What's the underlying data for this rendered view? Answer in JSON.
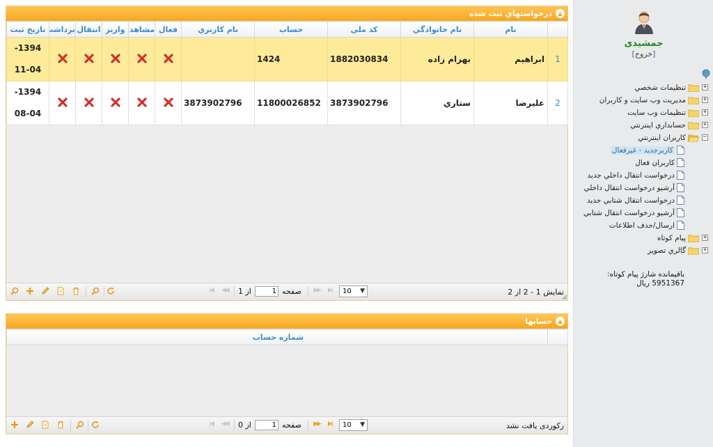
{
  "sidebar": {
    "user_name": "جمشیدی",
    "logout": "خروج",
    "tree": [
      {
        "label": "تنظيمات شخصي",
        "type": "folder",
        "expander": "+"
      },
      {
        "label": "مديريت وب سايت و کاربران",
        "type": "folder",
        "expander": "+"
      },
      {
        "label": "تنظيمات وب سايت",
        "type": "folder",
        "expander": "+"
      },
      {
        "label": "حسابداري اينترنتي",
        "type": "folder",
        "expander": "+"
      },
      {
        "label": "کاربران اينترنتي",
        "type": "folder-open",
        "expander": "−"
      },
      {
        "label": "کاربرجديد - غيرفعال",
        "type": "page",
        "selected": true
      },
      {
        "label": "کاربران فعال",
        "type": "page"
      },
      {
        "label": "درخواست انتقال داخلي جديد",
        "type": "page"
      },
      {
        "label": "آرشيو درخواست انتقال داخلي",
        "type": "page"
      },
      {
        "label": "درخواست انتقال شتابي جديد",
        "type": "page"
      },
      {
        "label": "آرشيو درخواست انتقال شتابي",
        "type": "page"
      },
      {
        "label": "ارسال/حذف اطلاعات",
        "type": "page"
      },
      {
        "label": "پيام کوتاه",
        "type": "folder",
        "expander": "+"
      },
      {
        "label": "گالري تصوير",
        "type": "folder",
        "expander": "+"
      }
    ],
    "sms_label": "باقیمانده شارژ پیام کوتاه:",
    "sms_value": "5951367 ریال"
  },
  "requests_panel": {
    "title": "درخواستهاي ثبت شده",
    "columns": [
      "",
      "نام",
      "نام خانوادگي",
      "کد ملي",
      "حساب",
      "نام کاربري",
      "فعال",
      "مشاهده",
      "واريز",
      "انتقال",
      "برداشت",
      "تاريخ ثبت"
    ],
    "rows": [
      {
        "num": "1",
        "name": "ابراهيم",
        "family": "بهرام زاده",
        "national_code": "1882030834",
        "account": "1424",
        "username": "",
        "date": "1394-11-04",
        "date_a": "1394-",
        "date_b": "11-04"
      },
      {
        "num": "2",
        "name": "عليرضا",
        "family": "ستاري",
        "national_code": "3873902796",
        "account": "11800026852",
        "username": "3873902796",
        "date": "1394-08-04",
        "date_a": "1394-",
        "date_b": "08-04"
      }
    ],
    "pager": {
      "display_text": "نمایش 1 - 2 از 2",
      "page_label": "صفحه",
      "page_value": "1",
      "of_text": "از 1",
      "page_size": "10"
    }
  },
  "accounts_panel": {
    "title": "حسابها",
    "columns": [
      "",
      "شماره حساب"
    ],
    "pager": {
      "display_text": "رکوردی یافت نشد",
      "page_label": "صفحه",
      "page_value": "1",
      "of_text": "از 0",
      "page_size": "10"
    }
  },
  "colors": {
    "header_orange": "#f7a71d",
    "selected_row": "#fdeb9a",
    "column_header_text": "#3d8bc4",
    "x_icon": "#d0302a"
  },
  "icons": [
    "user-avatar-icon",
    "globe-icon",
    "folder-icon",
    "page-icon",
    "x-icon",
    "search-icon",
    "add-icon",
    "edit-icon",
    "view-icon",
    "delete-icon",
    "refresh-icon"
  ]
}
